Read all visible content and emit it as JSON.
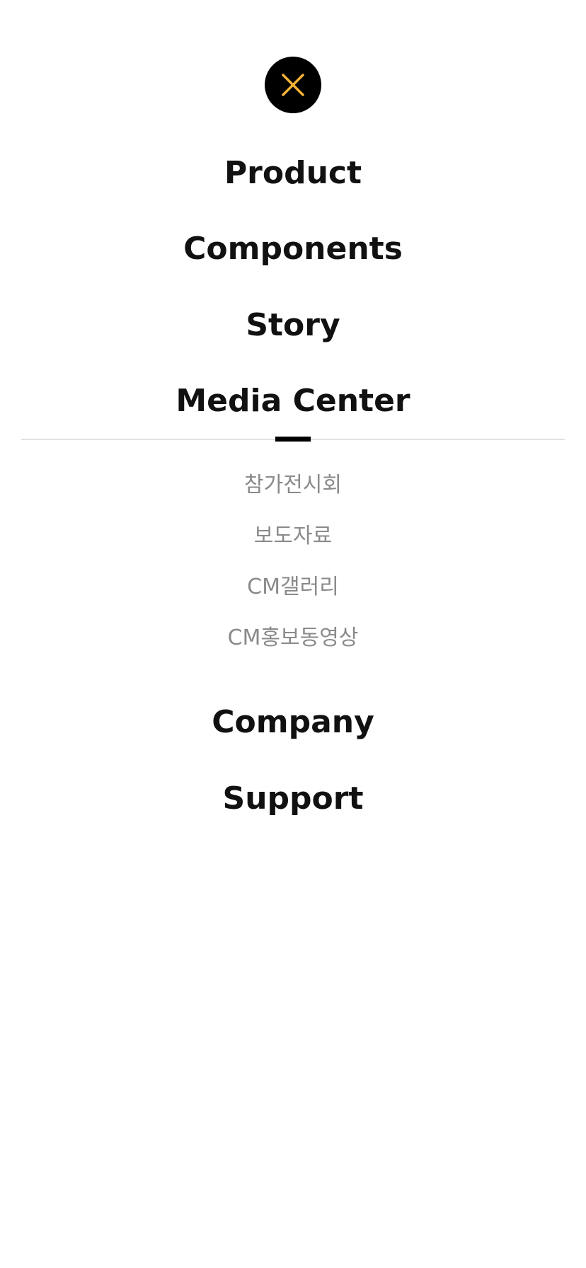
{
  "close_button": {
    "icon": "close-icon",
    "icon_color": "#f5b335",
    "bg_color": "#000000"
  },
  "menu": {
    "items": [
      {
        "label": "Product"
      },
      {
        "label": "Components"
      },
      {
        "label": "Story"
      },
      {
        "label": "Media Center",
        "active": true
      }
    ],
    "submenu": [
      {
        "label": "참가전시회"
      },
      {
        "label": "보도자료"
      },
      {
        "label": "CM갤러리"
      },
      {
        "label": "CM홍보동영상"
      }
    ],
    "items_after": [
      {
        "label": "Company"
      },
      {
        "label": "Support"
      }
    ]
  },
  "colors": {
    "text_primary": "#111111",
    "text_secondary": "#8a8a8a",
    "divider": "#e2e2e2",
    "accent": "#f5b335"
  }
}
